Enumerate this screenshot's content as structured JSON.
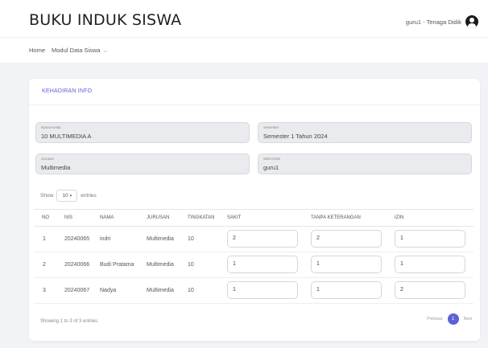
{
  "app": {
    "title": "BUKU INDUK SISWA"
  },
  "user": {
    "label": "guru1 - Tenaga Didik"
  },
  "nav": {
    "home": "Home",
    "modul": "Modul Data Siswa"
  },
  "card": {
    "title": "KEHADIRAN INFO"
  },
  "fields": {
    "kelas": {
      "label": "Nama Kelas",
      "value": "10 MULTIMEDIA A"
    },
    "semester": {
      "label": "Semester",
      "value": "Semester 1 Tahun 2024"
    },
    "jurusan": {
      "label": "Jurusan",
      "value": "Multimedia"
    },
    "wali": {
      "label": "Wali Kelas",
      "value": "guru1"
    }
  },
  "entries": {
    "show": "Show",
    "count": "10",
    "suffix": "entries"
  },
  "table": {
    "headers": [
      "NO",
      "NIS",
      "NAMA",
      "JURUSAN",
      "TINGKATAN",
      "SAKIT",
      "TANPA KETERANGAN",
      "IZIN"
    ],
    "rows": [
      {
        "no": "1",
        "nis": "20240065",
        "nama": "indri",
        "jurusan": "Multimedia",
        "tingkatan": "10",
        "sakit": "2",
        "tanpa": "2",
        "izin": "1"
      },
      {
        "no": "2",
        "nis": "20240066",
        "nama": "Budi Pratama",
        "jurusan": "Multimedia",
        "tingkatan": "10",
        "sakit": "1",
        "tanpa": "1",
        "izin": "1"
      },
      {
        "no": "3",
        "nis": "20240067",
        "nama": "Nadya",
        "jurusan": "Multimedia",
        "tingkatan": "10",
        "sakit": "1",
        "tanpa": "1",
        "izin": "2"
      }
    ]
  },
  "footer": {
    "info": "Showing 1 to 3 of 3 entries"
  },
  "pager": {
    "prev": "Previous",
    "current": "1",
    "next": "Next"
  },
  "colors": {
    "accent": "#5b61d6",
    "field_bg": "#e9ebee"
  },
  "icons": {
    "avatar": "user-avatar-icon",
    "caret": "chevron-down-icon"
  }
}
